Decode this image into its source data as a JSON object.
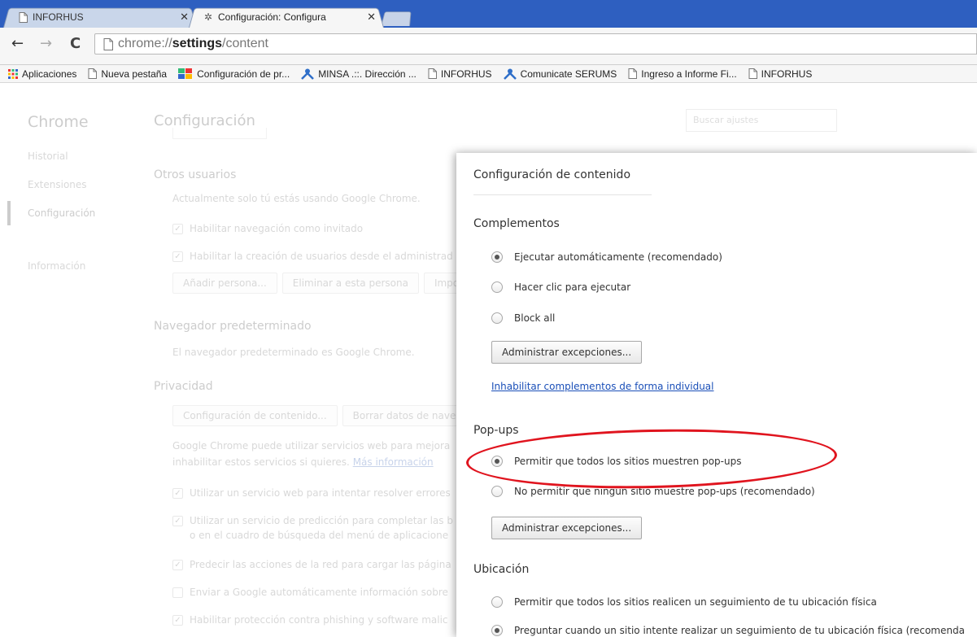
{
  "tabs": [
    {
      "title": "INFORHUS",
      "active": false
    },
    {
      "title": "Configuración: Configura",
      "active": true
    }
  ],
  "omnibox": {
    "scheme": "chrome://",
    "host": "settings",
    "path": "/content"
  },
  "bookmarks": [
    {
      "label": "Aplicaciones",
      "icon": "apps-grid-icon"
    },
    {
      "label": "Nueva pestaña",
      "icon": "page-icon"
    },
    {
      "label": "Configuración de pr...",
      "icon": "google-icon"
    },
    {
      "label": "MINSA .::. Dirección ...",
      "icon": "person-icon"
    },
    {
      "label": "INFORHUS",
      "icon": "page-icon"
    },
    {
      "label": "Comunicate SERUMS",
      "icon": "person-icon"
    },
    {
      "label": "Ingreso a Informe Fi...",
      "icon": "page-icon"
    },
    {
      "label": "INFORHUS",
      "icon": "page-icon"
    }
  ],
  "settings": {
    "brand": "Chrome",
    "nav": [
      "Historial",
      "Extensiones",
      "Configuración",
      "Información"
    ],
    "title": "Configuración",
    "search_placeholder": "Buscar ajustes",
    "otros": {
      "heading": "Otros usuarios",
      "desc": "Actualmente solo tú estás usando Google Chrome.",
      "chk1": "Habilitar navegación como invitado",
      "chk2": "Habilitar la creación de usuarios desde el administrad",
      "btn1": "Añadir persona...",
      "btn2": "Eliminar a esta persona",
      "btn3": "Impo"
    },
    "navegador": {
      "heading": "Navegador predeterminado",
      "desc": "El navegador predeterminado es Google Chrome."
    },
    "privacidad": {
      "heading": "Privacidad",
      "btn1": "Configuración de contenido...",
      "btn2": "Borrar datos de nave",
      "desc1": "Google Chrome puede utilizar servicios web para mejora",
      "desc2": "inhabilitar estos servicios si quieres.",
      "link": "Más información",
      "c1": "Utilizar un servicio web para intentar resolver errores",
      "c2a": "Utilizar un servicio de predicción para completar las b",
      "c2b": "o en el cuadro de búsqueda del menú de aplicacione",
      "c3": "Predecir las acciones de la red para cargar las página",
      "c4": "Enviar a Google automáticamente información sobre",
      "c5": "Habilitar protección contra phishing y software malic"
    }
  },
  "dialog": {
    "title": "Configuración de contenido",
    "complementos": {
      "heading": "Complementos",
      "opt1": "Ejecutar automáticamente (recomendado)",
      "opt2": "Hacer clic para ejecutar",
      "opt3": "Block all",
      "selected": 1,
      "button": "Administrar excepciones...",
      "link": "Inhabilitar complementos de forma individual"
    },
    "popups": {
      "heading": "Pop-ups",
      "opt1": "Permitir que todos los sitios muestren pop-ups",
      "opt2": "No permitir que ningún sitio muestre pop-ups (recomendado)",
      "selected": 1,
      "button": "Administrar excepciones..."
    },
    "ubicacion": {
      "heading": "Ubicación",
      "opt1": "Permitir que todos los sitios realicen un seguimiento de tu ubicación física",
      "opt2": "Preguntar cuando un sitio intente realizar un seguimiento de tu ubicación física (recomenda",
      "selected": 2
    }
  },
  "colors": {
    "tabstrip": "#2e5fc0",
    "link": "#1a4fb8",
    "annotation": "#e0141e"
  }
}
